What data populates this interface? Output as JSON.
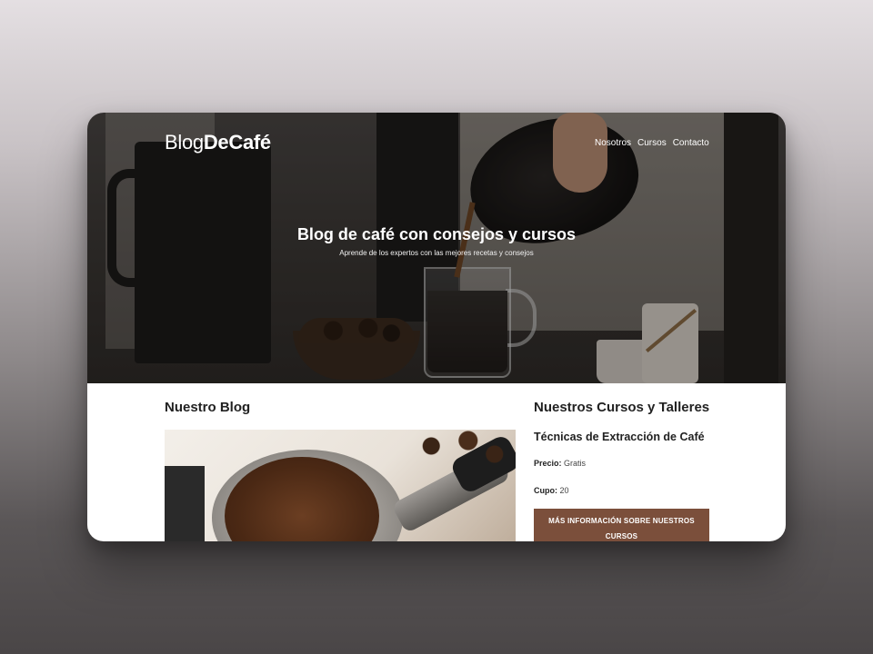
{
  "site": {
    "logo_light": "Blog",
    "logo_bold": "DeCafé",
    "nav": [
      "Nosotros",
      "Cursos",
      "Contacto"
    ]
  },
  "hero": {
    "title": "Blog de café con consejos y cursos",
    "subtitle": "Aprende de los expertos con las mejores recetas y consejos"
  },
  "blog": {
    "heading": "Nuestro Blog"
  },
  "courses": {
    "heading": "Nuestros Cursos y Talleres",
    "course_title": "Técnicas de Extracción de Café",
    "price_label": "Precio:",
    "price_value": "Gratis",
    "spots_label": "Cupo:",
    "spots_value": "20",
    "button_label": "Más información sobre nuestros cursos"
  },
  "colors": {
    "accent": "#7b4f3b"
  }
}
